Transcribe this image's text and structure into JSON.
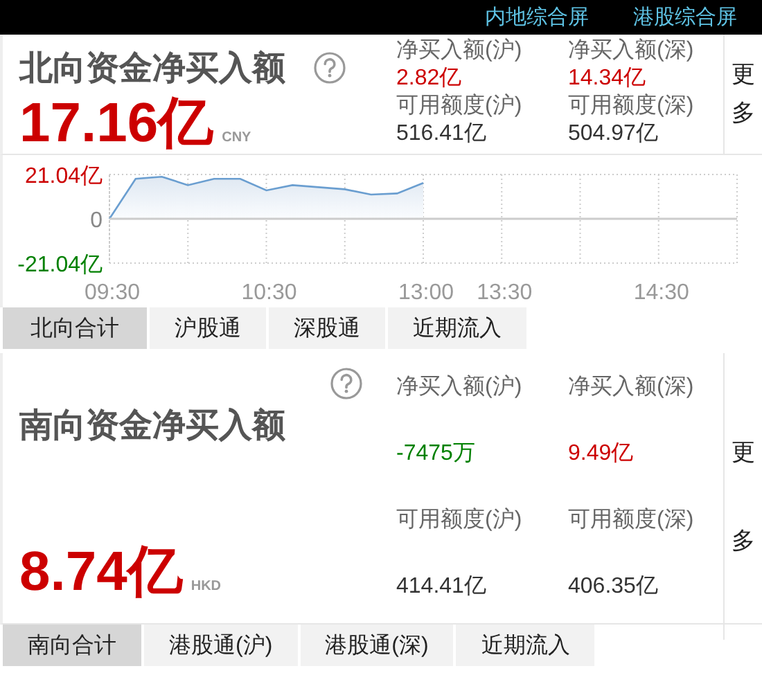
{
  "top_links": [
    {
      "label": "内地综合屏"
    },
    {
      "label": "港股综合屏"
    }
  ],
  "north": {
    "title": "北向资金净买入额",
    "total": "17.16亿",
    "currency": "CNY",
    "stats": [
      {
        "label": "净买入额(沪)",
        "value": "2.82亿",
        "color": "#cc0000"
      },
      {
        "label": "净买入额(深)",
        "value": "14.34亿",
        "color": "#cc0000"
      },
      {
        "label": "可用额度(沪)",
        "value": "516.41亿",
        "color": "#333333"
      },
      {
        "label": "可用额度(深)",
        "value": "504.97亿",
        "color": "#333333"
      }
    ],
    "more": "更多",
    "chart_data": {
      "type": "area",
      "categories": [
        "09:30",
        null,
        null,
        null,
        null,
        null,
        "10:30",
        null,
        null,
        null,
        null,
        null,
        "13:00",
        null,
        null,
        "13:30",
        null,
        null,
        null,
        null,
        null,
        "14:30",
        null,
        null,
        null
      ],
      "series": [
        {
          "color": "#6a9ed0",
          "values": [
            0,
            19,
            20,
            16,
            19,
            19,
            13.5,
            16,
            15,
            14,
            11.5,
            12,
            17,
            null,
            null,
            null,
            null,
            null,
            null,
            null,
            null,
            null,
            null,
            null,
            null
          ]
        }
      ],
      "ylim": [
        -21.04,
        21.04
      ],
      "grid": true,
      "yticks": [
        {
          "value": 21.04,
          "label": "21.04亿"
        },
        {
          "value": 0,
          "label": "0"
        },
        {
          "value": -21.04,
          "label": "-21.04亿"
        }
      ]
    },
    "tabs": [
      {
        "label": "北向合计",
        "selected": true
      },
      {
        "label": "沪股通",
        "selected": false
      },
      {
        "label": "深股通",
        "selected": false
      },
      {
        "label": "近期流入",
        "selected": false
      }
    ]
  },
  "south": {
    "title": "南向资金净买入额",
    "total": "8.74亿",
    "currency": "HKD",
    "stats": [
      {
        "label": "净买入额(沪)",
        "value": "-7475万",
        "color": "#008000"
      },
      {
        "label": "净买入额(深)",
        "value": "9.49亿",
        "color": "#cc0000"
      },
      {
        "label": "可用额度(沪)",
        "value": "414.41亿",
        "color": "#333333"
      },
      {
        "label": "可用额度(深)",
        "value": "406.35亿",
        "color": "#333333"
      }
    ],
    "more": "更多",
    "tabs": [
      {
        "label": "南向合计",
        "selected": true
      },
      {
        "label": "港股通(沪)",
        "selected": false
      },
      {
        "label": "港股通(深)",
        "selected": false
      },
      {
        "label": "近期流入",
        "selected": false
      }
    ]
  }
}
